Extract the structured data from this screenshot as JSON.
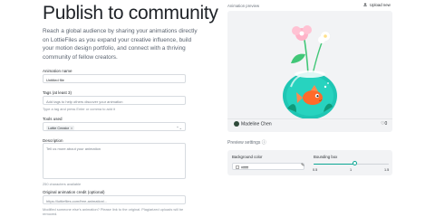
{
  "header": {
    "title": "Publish to community",
    "intro": "Reach a global audience by sharing your animations directly on LottieFiles as you expand your creative influence, build your motion design portfolio, and connect with a thriving community of fellow creators."
  },
  "form": {
    "name_label": "Animation name",
    "name_value": "Untitled file",
    "tags_label": "Tags (at least 3)",
    "tags_placeholder": "Add tags to help others discover your animation",
    "tags_help": "Type a tag and press Enter or comma to add it",
    "tools_label": "Tools used",
    "tools_chip": "Lottie Creator",
    "tools_chip_remove": "×",
    "description_label": "Description",
    "description_placeholder": "Tell us more about your animation",
    "description_help": "250 characters available",
    "credit_label": "Original animation credit (optional)",
    "credit_placeholder": "https://lottiefiles.com/free-animation/...",
    "credit_help": "Modified someone else's animation? Please link to the original. Plagiarized uploads will be removed."
  },
  "preview": {
    "heading": "Animation preview",
    "upload_label": "Upload new",
    "author": "Madeline Chen",
    "likes": "0"
  },
  "settings": {
    "heading": "Preview settings",
    "bg_label": "Background color",
    "bg_value": "#ffffff",
    "bbox_label": "Bounding box",
    "bbox_value": 1.05,
    "bbox_min": 0.5,
    "bbox_max": 1.5,
    "ticks": [
      "0.5",
      "1",
      "1.5"
    ]
  },
  "colors": {
    "accent": "#0aa693",
    "bowl": "#1fc6b4",
    "fish": "#ff6a2b",
    "flower": "#ffb3c8",
    "leaf": "#41c777"
  }
}
